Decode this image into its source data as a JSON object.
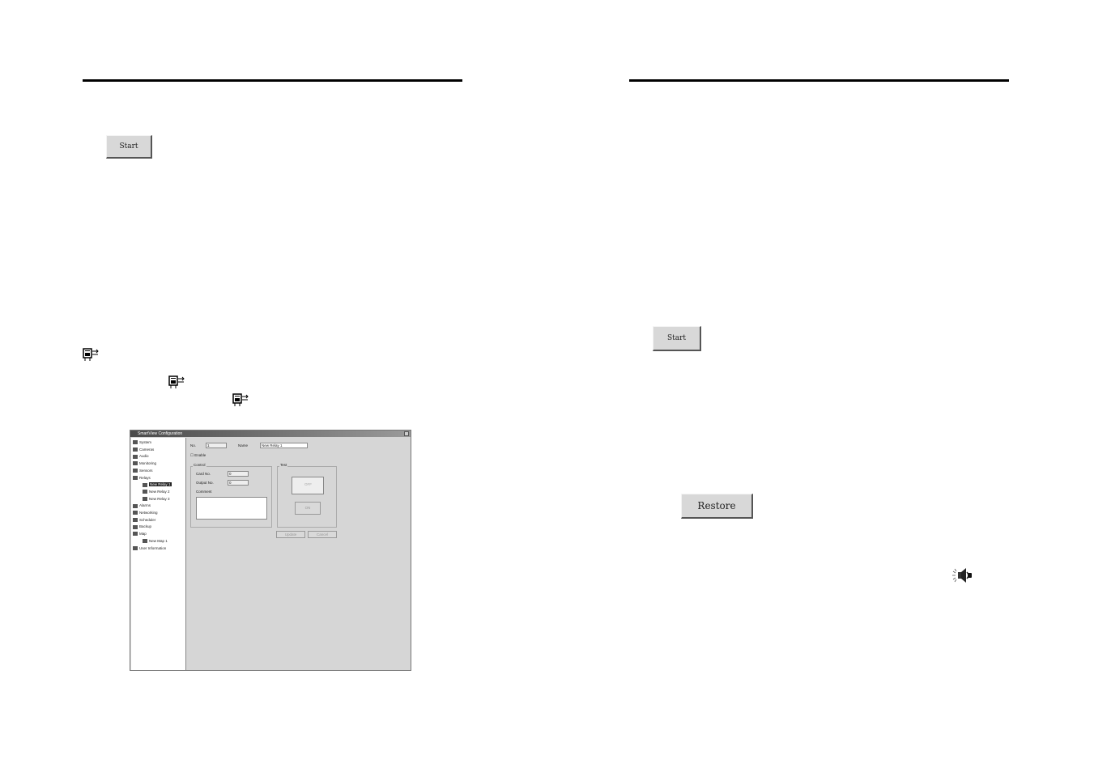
{
  "left_page": {
    "start_button": "Start"
  },
  "right_page": {
    "start_button": "Start",
    "restore_button": "Restore"
  },
  "icons": {
    "relay": "relay-icon",
    "speaker": "speaker-icon"
  },
  "config_window": {
    "title": "SmartView Configuration",
    "tree": [
      {
        "label": "System",
        "indent": 0
      },
      {
        "label": "Cameras",
        "indent": 0
      },
      {
        "label": "Audio",
        "indent": 0
      },
      {
        "label": "Monitoring",
        "indent": 0
      },
      {
        "label": "Sensors",
        "indent": 0
      },
      {
        "label": "Relays",
        "indent": 0
      },
      {
        "label": "New Relay 1",
        "indent": 1,
        "selected": true
      },
      {
        "label": "New Relay 2",
        "indent": 1
      },
      {
        "label": "New Relay 3",
        "indent": 1
      },
      {
        "label": "Alarms",
        "indent": 0
      },
      {
        "label": "Networking",
        "indent": 0
      },
      {
        "label": "Scheduler",
        "indent": 0
      },
      {
        "label": "Backup",
        "indent": 0
      },
      {
        "label": "Map",
        "indent": 0
      },
      {
        "label": "New Map 1",
        "indent": 1
      },
      {
        "label": "User Information",
        "indent": 0
      }
    ],
    "no_label": "No.",
    "no_value": "1",
    "name_label": "Name",
    "name_value": "New Relay 1",
    "enable_label": "Enable",
    "control_group": "Control",
    "card_no_label": "Card No.",
    "card_no_value": "0",
    "output_no_label": "Output No.",
    "output_no_value": "0",
    "comment_label": "Comment",
    "test_group": "Test",
    "test_display": "OFF",
    "test_button": "ON",
    "update_button": "Update",
    "cancel_button": "Cancel"
  }
}
